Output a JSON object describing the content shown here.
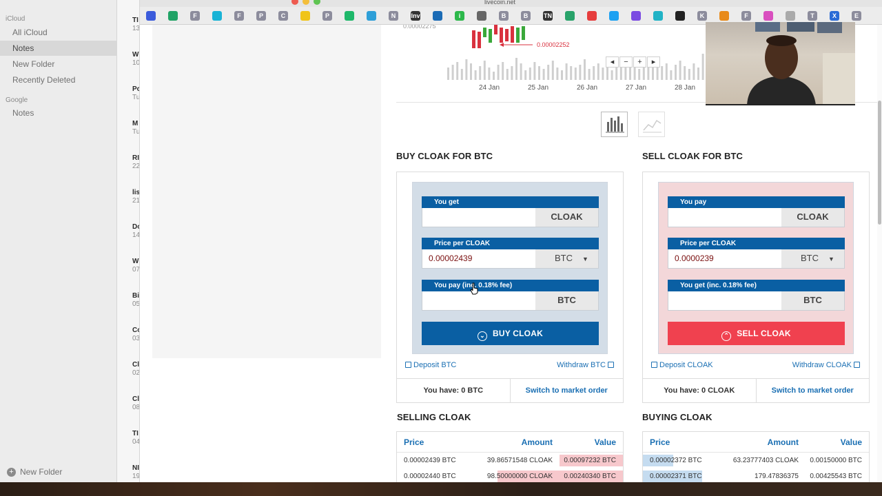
{
  "notes_sidebar": {
    "groups": [
      {
        "header": "iCloud",
        "items": [
          "All iCloud",
          "Notes",
          "New Folder",
          "Recently Deleted"
        ]
      },
      {
        "header": "Google",
        "items": [
          "Notes"
        ]
      }
    ],
    "selected": "Notes",
    "new_folder_label": "New Folder"
  },
  "notes_list": [
    {
      "title": "TI",
      "sub": "13"
    },
    {
      "title": "W",
      "sub": "10"
    },
    {
      "title": "Po",
      "sub": "Tu"
    },
    {
      "title": "M",
      "sub": "Tu"
    },
    {
      "title": "RI",
      "sub": "22"
    },
    {
      "title": "lis",
      "sub": "21"
    },
    {
      "title": "Do",
      "sub": "14"
    },
    {
      "title": "W",
      "sub": "07"
    },
    {
      "title": "Bi",
      "sub": "05"
    },
    {
      "title": "Cc",
      "sub": "03"
    },
    {
      "title": "Cl",
      "sub": "02"
    },
    {
      "title": "Cl",
      "sub": "08"
    },
    {
      "title": "TI",
      "sub": "04"
    },
    {
      "title": "NI",
      "sub": "19"
    }
  ],
  "browser": {
    "url": "livecoin.net",
    "bookmarks": [
      {
        "name": "bookmark-cm",
        "label": "",
        "color": "#3b5bdb"
      },
      {
        "name": "bookmark-sheets",
        "label": "",
        "color": "#21a366"
      },
      {
        "name": "bookmark-f1",
        "label": "F",
        "color": "#8c8c9c"
      },
      {
        "name": "bookmark-circle",
        "label": "",
        "color": "#19b3d6"
      },
      {
        "name": "bookmark-f2",
        "label": "F",
        "color": "#8c8c9c"
      },
      {
        "name": "bookmark-p1",
        "label": "P",
        "color": "#8c8c9c"
      },
      {
        "name": "bookmark-c",
        "label": "C",
        "color": "#8c8c9c"
      },
      {
        "name": "bookmark-yellow",
        "label": "",
        "color": "#f0c419"
      },
      {
        "name": "bookmark-p2",
        "label": "P",
        "color": "#8c8c9c"
      },
      {
        "name": "bookmark-green",
        "label": "",
        "color": "#1fb86a"
      },
      {
        "name": "bookmark-cloud",
        "label": "",
        "color": "#2e9fd8"
      },
      {
        "name": "bookmark-n",
        "label": "N",
        "color": "#8c8c9c"
      },
      {
        "name": "bookmark-inv",
        "label": "Inv",
        "color": "#333333"
      },
      {
        "name": "bookmark-ex",
        "label": "",
        "color": "#1b6bb5"
      },
      {
        "name": "bookmark-i",
        "label": "i",
        "color": "#2db84b"
      },
      {
        "name": "bookmark-w",
        "label": "",
        "color": "#666666"
      },
      {
        "name": "bookmark-b1",
        "label": "B",
        "color": "#8c8c9c"
      },
      {
        "name": "bookmark-b2",
        "label": "B",
        "color": "#8c8c9c"
      },
      {
        "name": "bookmark-tn",
        "label": "TN",
        "color": "#333333"
      },
      {
        "name": "bookmark-grid",
        "label": "",
        "color": "#29a36a"
      },
      {
        "name": "bookmark-bar",
        "label": "",
        "color": "#e63d3d"
      },
      {
        "name": "bookmark-twitter",
        "label": "",
        "color": "#1da1f2"
      },
      {
        "name": "bookmark-purple",
        "label": "",
        "color": "#7b4ae2"
      },
      {
        "name": "bookmark-teal",
        "label": "",
        "color": "#21b3c6"
      },
      {
        "name": "bookmark-c2",
        "label": "",
        "color": "#222222"
      },
      {
        "name": "bookmark-k",
        "label": "K",
        "color": "#8c8c9c"
      },
      {
        "name": "bookmark-o",
        "label": "",
        "color": "#e88a1a"
      },
      {
        "name": "bookmark-f3",
        "label": "F",
        "color": "#8c8c9c"
      },
      {
        "name": "bookmark-pink",
        "label": "",
        "color": "#d94fbf"
      },
      {
        "name": "bookmark-f4",
        "label": "",
        "color": "#aaaaaa"
      },
      {
        "name": "bookmark-t",
        "label": "T",
        "color": "#8c8c9c"
      },
      {
        "name": "bookmark-x",
        "label": "X",
        "color": "#2a6bd6"
      },
      {
        "name": "bookmark-e",
        "label": "E",
        "color": "#8c8c9c"
      }
    ]
  },
  "chart": {
    "top_value": "0.00002275",
    "last_price_label": "0.00002252",
    "dates": [
      "24 Jan",
      "25 Jan",
      "26 Jan",
      "27 Jan",
      "28 Jan"
    ],
    "controls": [
      "◂",
      "−",
      "+",
      "▸"
    ],
    "colors": {
      "up": "#3aa83a",
      "down": "#d9313e",
      "volume": "#cfcfcf"
    },
    "chart_type_options": [
      "bar-chart-icon",
      "line-chart-icon"
    ]
  },
  "buy": {
    "title": "BUY CLOAK FOR BTC",
    "you_get_label": "You get",
    "you_get_value": "",
    "you_get_currency": "CLOAK",
    "price_label": "Price per CLOAK",
    "price_value": "0.00002439",
    "price_currency": "BTC",
    "pay_label": "You pay (inc. 0.18% fee)",
    "pay_value": "",
    "pay_currency": "BTC",
    "button": "BUY CLOAK",
    "deposit": "Deposit BTC",
    "withdraw": "Withdraw BTC",
    "you_have": "You have: 0 BTC",
    "switch": "Switch to market order"
  },
  "sell": {
    "title": "SELL CLOAK FOR BTC",
    "you_pay_label": "You pay",
    "you_pay_value": "",
    "you_pay_currency": "CLOAK",
    "price_label": "Price per CLOAK",
    "price_value": "0.0000239",
    "price_currency": "BTC",
    "get_label": "You get (inc. 0.18% fee)",
    "get_value": "",
    "get_currency": "BTC",
    "button": "SELL CLOAK",
    "deposit": "Deposit CLOAK",
    "withdraw": "Withdraw CLOAK",
    "you_have": "You have: 0 CLOAK",
    "switch": "Switch to market order"
  },
  "selling": {
    "title": "SELLING CLOAK",
    "headers": [
      "Price",
      "Amount",
      "Value"
    ],
    "rows": [
      [
        "0.00002439 BTC",
        "39.86571548 CLOAK",
        "0.00097232 BTC"
      ],
      [
        "0.00002440 BTC",
        "98.50000000 CLOAK",
        "0.00240340 BTC"
      ]
    ]
  },
  "buying": {
    "title": "BUYING CLOAK",
    "headers": [
      "Price",
      "Amount",
      "Value"
    ],
    "rows": [
      [
        "0.00002372 BTC",
        "63.23777403 CLOAK",
        "0.00150000 BTC"
      ],
      [
        "0.00002371 BTC",
        "179.47836375",
        "0.00425543 BTC"
      ]
    ]
  }
}
